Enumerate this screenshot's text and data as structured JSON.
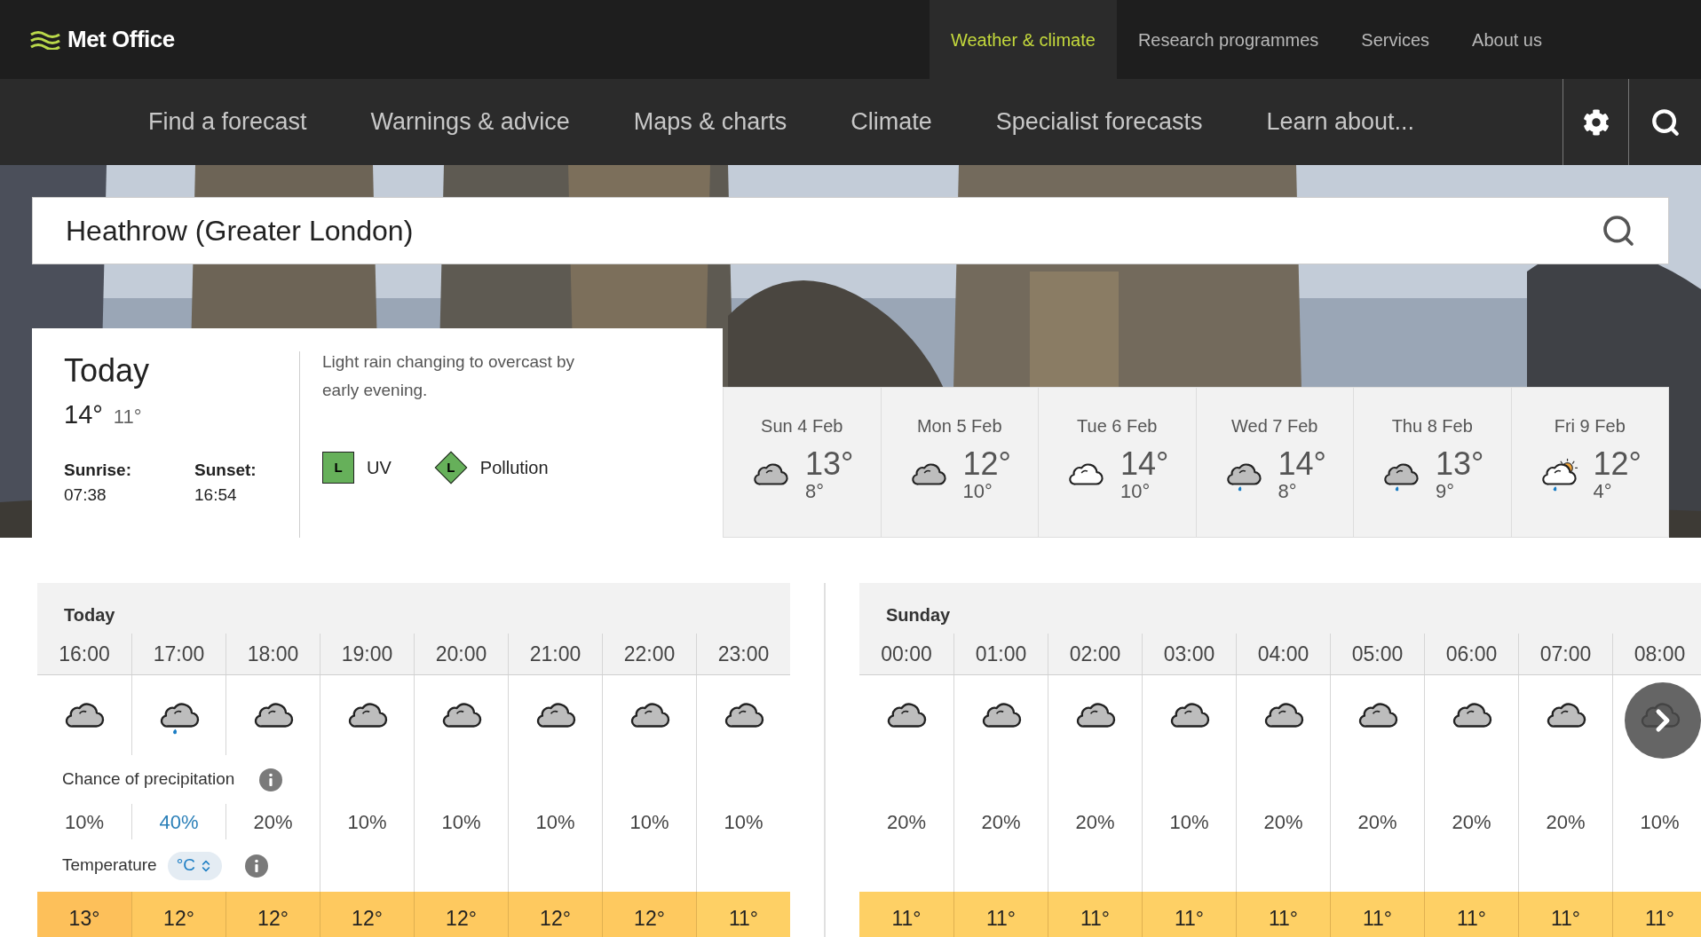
{
  "header": {
    "logo": "Met Office",
    "top_nav": [
      {
        "label": "Weather & climate",
        "selected": true
      },
      {
        "label": "Research programmes",
        "selected": false
      },
      {
        "label": "Services",
        "selected": false
      },
      {
        "label": "About us",
        "selected": false
      }
    ],
    "main_nav": [
      "Find a forecast",
      "Warnings & advice",
      "Maps & charts",
      "Climate",
      "Specialist forecasts",
      "Learn about..."
    ]
  },
  "search": {
    "value": "Heathrow (Greater London)"
  },
  "today": {
    "title": "Today",
    "high": "14°",
    "low": "11°",
    "sunrise_label": "Sunrise:",
    "sunrise": "07:38",
    "sunset_label": "Sunset:",
    "sunset": "16:54",
    "summary": "Light rain changing to overcast by early evening.",
    "indices": [
      {
        "kind": "square",
        "level": "L",
        "label": "UV",
        "color": "#66b05a"
      },
      {
        "kind": "diamond",
        "level": "L",
        "label": "Pollution",
        "color": "#66b05a"
      }
    ]
  },
  "daily": [
    {
      "date": "Sun 4 Feb",
      "kind": "cloudy",
      "high": "13°",
      "low": "8°"
    },
    {
      "date": "Mon 5 Feb",
      "kind": "cloudy",
      "high": "12°",
      "low": "10°"
    },
    {
      "date": "Tue 6 Feb",
      "kind": "light-cloud",
      "high": "14°",
      "low": "10°"
    },
    {
      "date": "Wed 7 Feb",
      "kind": "light-rain",
      "high": "14°",
      "low": "8°"
    },
    {
      "date": "Thu 8 Feb",
      "kind": "light-rain",
      "high": "13°",
      "low": "9°"
    },
    {
      "date": "Fri 9 Feb",
      "kind": "sun-rain",
      "high": "12°",
      "low": "4°"
    }
  ],
  "hourly": [
    {
      "day": "Today",
      "precip_label": "Chance of precipitation",
      "temp_label": "Temperature",
      "unit": "°C",
      "hours": [
        {
          "time": "16:00",
          "kind": "cloudy",
          "precip": "10%",
          "precip_high": false,
          "temp": "13°",
          "color": "#fdc05a"
        },
        {
          "time": "17:00",
          "kind": "light-rain",
          "precip": "40%",
          "precip_high": true,
          "temp": "12°",
          "color": "#fec95f"
        },
        {
          "time": "18:00",
          "kind": "cloudy",
          "precip": "20%",
          "precip_high": false,
          "temp": "12°",
          "color": "#fec95f"
        },
        {
          "time": "19:00",
          "kind": "cloudy",
          "precip": "10%",
          "precip_high": false,
          "temp": "12°",
          "color": "#fec95f"
        },
        {
          "time": "20:00",
          "kind": "cloudy",
          "precip": "10%",
          "precip_high": false,
          "temp": "12°",
          "color": "#fec95f"
        },
        {
          "time": "21:00",
          "kind": "cloudy",
          "precip": "10%",
          "precip_high": false,
          "temp": "12°",
          "color": "#fec95f"
        },
        {
          "time": "22:00",
          "kind": "cloudy",
          "precip": "10%",
          "precip_high": false,
          "temp": "12°",
          "color": "#fec95f"
        },
        {
          "time": "23:00",
          "kind": "cloudy",
          "precip": "10%",
          "precip_high": false,
          "temp": "11°",
          "color": "#fed065"
        }
      ]
    },
    {
      "day": "Sunday",
      "hours": [
        {
          "time": "00:00",
          "kind": "cloudy",
          "precip": "20%",
          "precip_high": false,
          "temp": "11°",
          "color": "#fed065"
        },
        {
          "time": "01:00",
          "kind": "cloudy",
          "precip": "20%",
          "precip_high": false,
          "temp": "11°",
          "color": "#fed065"
        },
        {
          "time": "02:00",
          "kind": "cloudy",
          "precip": "20%",
          "precip_high": false,
          "temp": "11°",
          "color": "#fed065"
        },
        {
          "time": "03:00",
          "kind": "cloudy",
          "precip": "10%",
          "precip_high": false,
          "temp": "11°",
          "color": "#fed065"
        },
        {
          "time": "04:00",
          "kind": "cloudy",
          "precip": "20%",
          "precip_high": false,
          "temp": "11°",
          "color": "#fed065"
        },
        {
          "time": "05:00",
          "kind": "cloudy",
          "precip": "20%",
          "precip_high": false,
          "temp": "11°",
          "color": "#fed065"
        },
        {
          "time": "06:00",
          "kind": "cloudy",
          "precip": "20%",
          "precip_high": false,
          "temp": "11°",
          "color": "#fed065"
        },
        {
          "time": "07:00",
          "kind": "cloudy",
          "precip": "20%",
          "precip_high": false,
          "temp": "11°",
          "color": "#fed065"
        },
        {
          "time": "08:00",
          "kind": "cloudy",
          "precip": "10%",
          "precip_high": false,
          "temp": "11°",
          "color": "#fed065"
        }
      ]
    }
  ]
}
